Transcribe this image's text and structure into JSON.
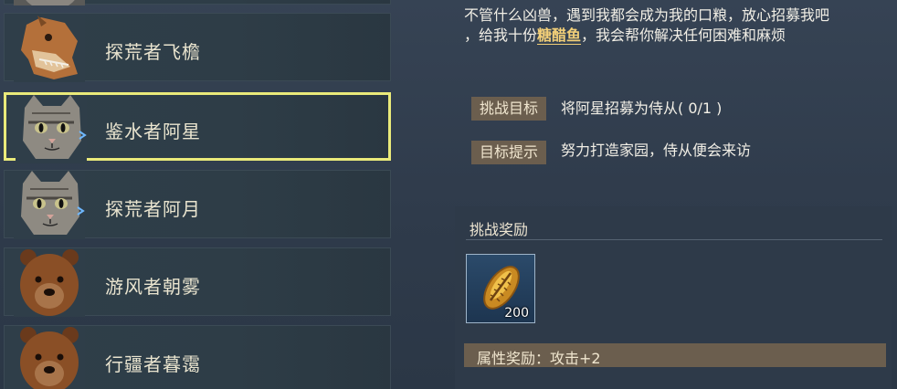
{
  "characters": [
    {
      "name": "",
      "portrait": "cat-portrait-icon"
    },
    {
      "name": "探荒者飞檐",
      "portrait": "dragon-portrait-icon"
    },
    {
      "name": "鉴水者阿星",
      "portrait": "cat-portrait-icon",
      "selected": true
    },
    {
      "name": "探荒者阿月",
      "portrait": "cat-portrait-icon"
    },
    {
      "name": "游风者朝雾",
      "portrait": "bear-portrait-icon"
    },
    {
      "name": "行疆者暮霭",
      "portrait": "bear-portrait-icon"
    }
  ],
  "detail": {
    "desc_line1": "不管什么凶兽，遇到我都会成为我的口粮，放心招募我吧",
    "desc_line2_pre": "，给我十份",
    "desc_highlight": "糖醋鱼",
    "desc_line2_post": "，我会帮你解决任何困难和麻烦",
    "challenge_tag": "挑战目标",
    "challenge_text": "将阿星招募为侍从( 0/1 )",
    "hint_tag": "目标提示",
    "hint_text": "努力打造家园，侍从便会来访"
  },
  "reward": {
    "title": "挑战奖励",
    "item_icon": "golden-shell-icon",
    "item_count": "200",
    "attr_text": "属性奖励：攻击+2"
  },
  "colors": {
    "highlight": "#f2cf78",
    "selected_border": "#eaea7a",
    "tag_bg": "#6b5e4e"
  }
}
